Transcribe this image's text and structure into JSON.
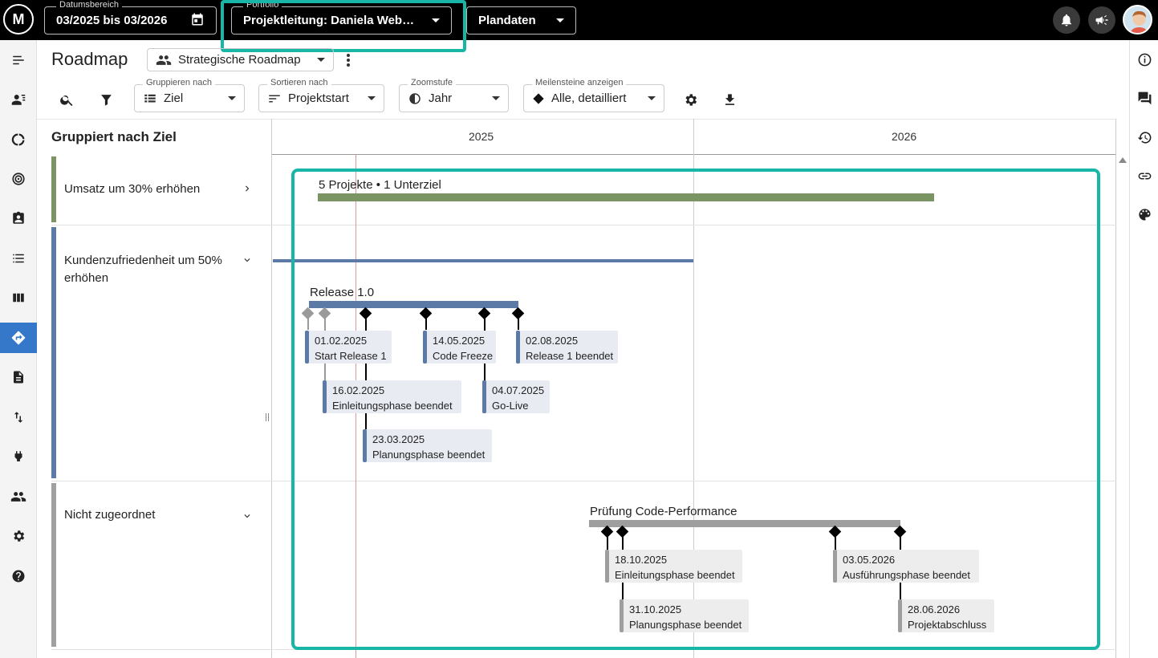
{
  "topbar": {
    "date_range_label": "Datumsbereich",
    "date_range_value": "03/2025 bis 03/2026",
    "portfolio_label": "Portfolio",
    "portfolio_value": "Projektleitung: Daniela Web…",
    "data_value": "Plandaten"
  },
  "header": {
    "title": "Roadmap",
    "roadmap_select": "Strategische Roadmap"
  },
  "toolbar": {
    "group_label": "Gruppieren nach",
    "group_value": "Ziel",
    "sort_label": "Sortieren nach",
    "sort_value": "Projektstart",
    "zoom_label": "Zoomstufe",
    "zoom_value": "Jahr",
    "milestones_label": "Meilensteine anzeigen",
    "milestones_value": "Alle, detailliert"
  },
  "grid": {
    "group_header": "Gruppiert nach Ziel",
    "years": [
      "2025",
      "2026"
    ]
  },
  "groups": [
    {
      "label": "Umsatz um 30% erhöhen",
      "color": "#7a9464"
    },
    {
      "label_line1": "Kundenzufriedenheit um 50%",
      "label_line2": "erhöhen",
      "color": "#5b7aa6"
    },
    {
      "label": "Nicht zugeordnet",
      "color": "#a0a0a0"
    }
  ],
  "bars": {
    "summary_label": "5 Projekte • 1 Unterziel",
    "release_label": "Release 1.0",
    "perf_label": "Prüfung Code-Performance"
  },
  "milestones": {
    "m1": {
      "date": "01.02.2025",
      "name": "Start Release 1"
    },
    "m2": {
      "date": "16.02.2025",
      "name": "Einleitungsphase beendet"
    },
    "m3": {
      "date": "23.03.2025",
      "name": "Planungsphase beendet"
    },
    "m4": {
      "date": "14.05.2025",
      "name": "Code Freeze"
    },
    "m5": {
      "date": "04.07.2025",
      "name": "Go-Live"
    },
    "m6": {
      "date": "02.08.2025",
      "name": "Release 1 beendet"
    },
    "p1": {
      "date": "18.10.2025",
      "name": "Einleitungsphase beendet"
    },
    "p2": {
      "date": "31.10.2025",
      "name": "Planungsphase beendet"
    },
    "p3": {
      "date": "03.05.2026",
      "name": "Ausführungsphase beendet"
    },
    "p4": {
      "date": "28.06.2026",
      "name": "Projektabschluss"
    }
  },
  "colors": {
    "accent_highlight": "#18b6a6",
    "nav_active": "#3577c9",
    "goal_green": "#7a9464",
    "goal_blue": "#5b7aa6",
    "unassigned_gray": "#a0a0a0"
  }
}
